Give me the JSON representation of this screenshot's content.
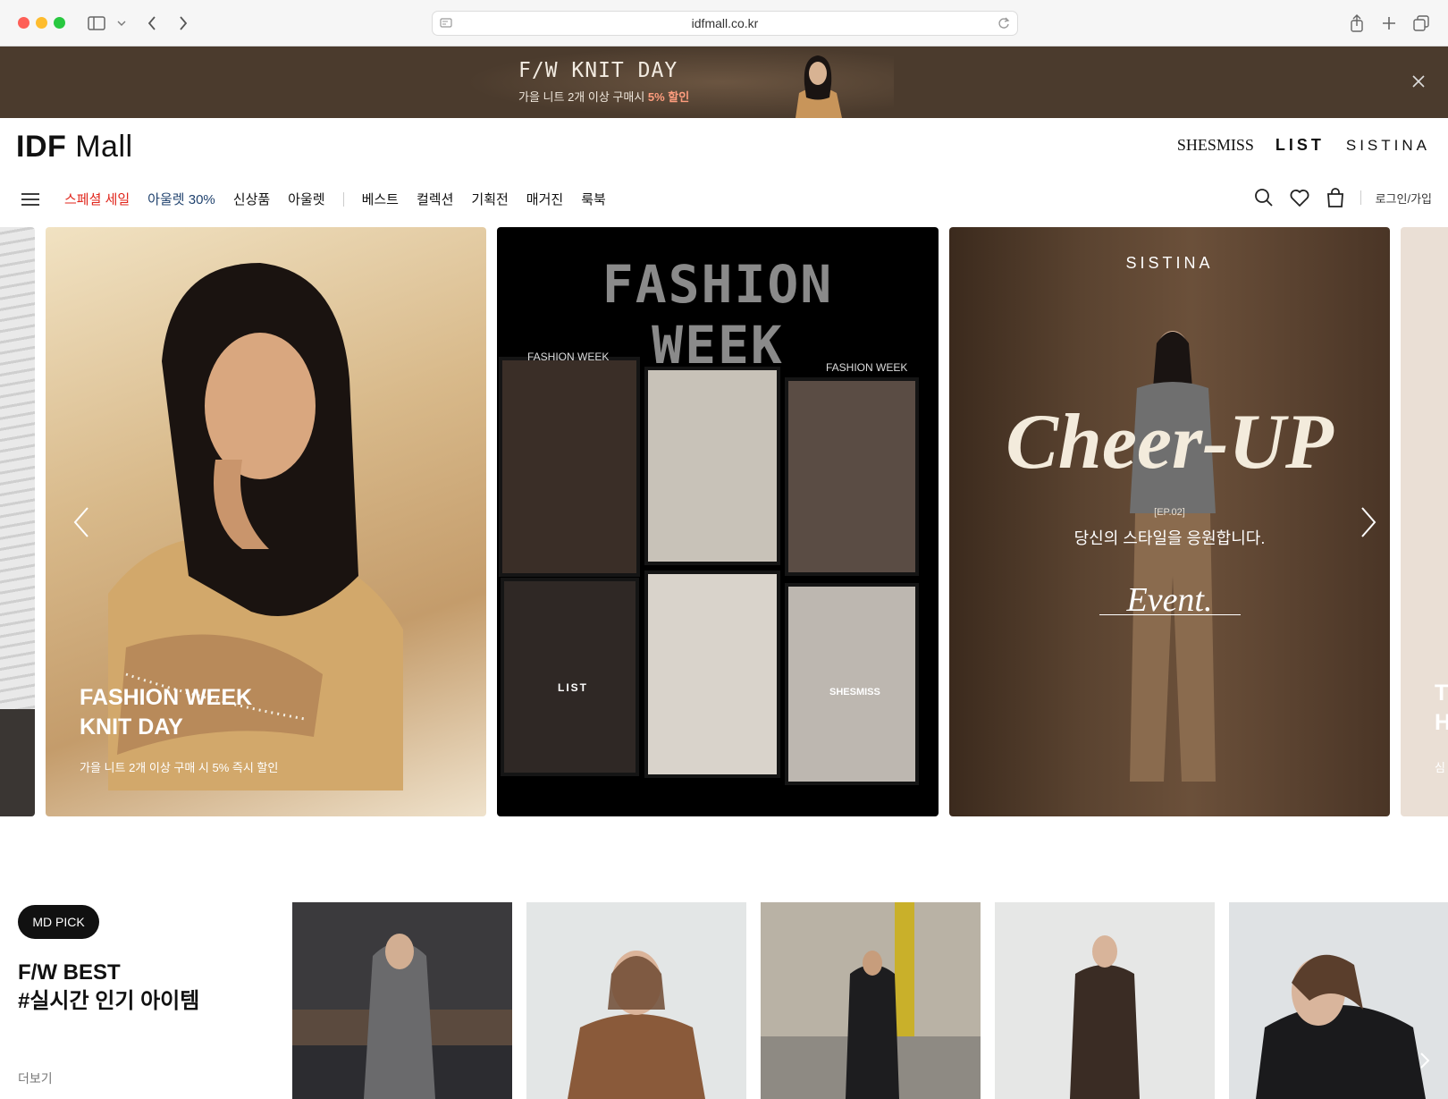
{
  "browser": {
    "url": "idfmall.co.kr"
  },
  "promo": {
    "title": "F/W KNIT DAY",
    "sub_prefix": "가을 니트 2개 이상 구매시",
    "sub_highlight": "5% 할인"
  },
  "header": {
    "logo_bold": "IDF",
    "logo_light": "Mall",
    "brands": [
      "SHESMISS",
      "LIST",
      "SISTINA"
    ]
  },
  "nav": {
    "items": [
      "스페셜 세일",
      "아울렛 30%",
      "신상품",
      "아울렛",
      "베스트",
      "컬렉션",
      "기획전",
      "매거진",
      "룩북"
    ],
    "login": "로그인/가입"
  },
  "carousel": {
    "slide1": {
      "headline_1": "FASHION WEEK",
      "headline_2": "KNIT DAY",
      "sub": "가을 니트 2개 이상 구매 시 5% 즉시 할인"
    },
    "slide2": {
      "title": "FASHION WEEK",
      "tag_1": "FASHION WEEK",
      "tag_2": "FASHION WEEK",
      "tag_list": "LIST",
      "tag_shesmiss": "SHESMISS"
    },
    "slide3": {
      "brand": "SISTINA",
      "title": "Cheer-UP",
      "ep": "[EP.02]",
      "message": "당신의 스타일을 응원합니다.",
      "event": "Event."
    },
    "slide4_partial": [
      "T",
      "H",
      "심"
    ]
  },
  "md_pick": {
    "badge": "MD PICK",
    "title_1": "F/W BEST",
    "title_2": "#실시간 인기 아이템",
    "more": "더보기"
  },
  "colors": {
    "sale_red": "#e0251b",
    "outlet_blue": "#21436f",
    "promo_bg": "#4b3b2d"
  }
}
